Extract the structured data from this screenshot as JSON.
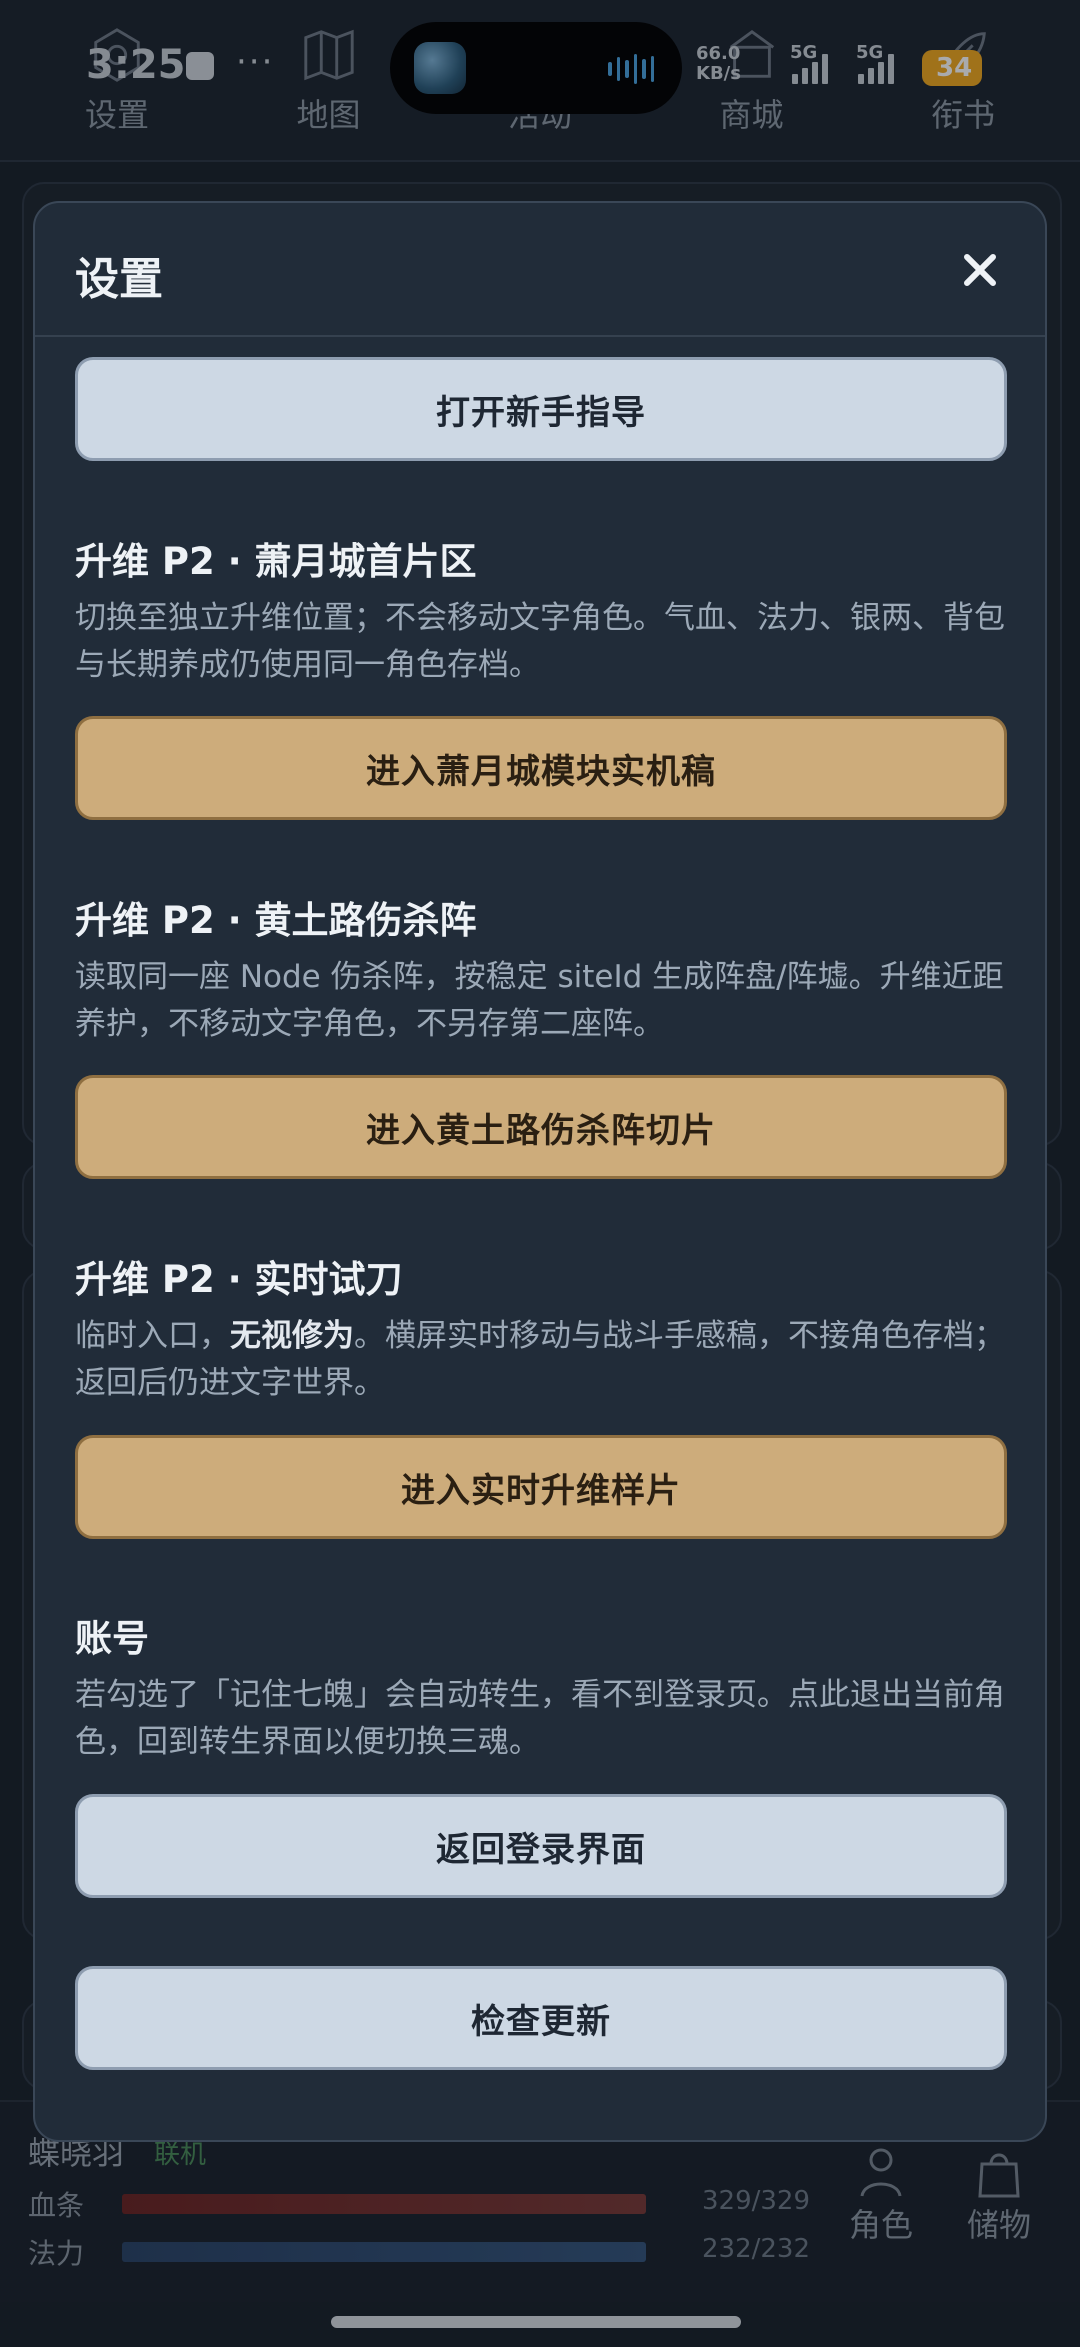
{
  "status_bar": {
    "time": "3:25",
    "dots": "···",
    "net_speed_value": "66.0",
    "net_speed_unit": "KB/s",
    "sim1": "5G",
    "sim2": "5G",
    "battery": "34"
  },
  "top_nav": {
    "items": [
      {
        "label": "设置",
        "icon": "gear-icon"
      },
      {
        "label": "地图",
        "icon": "map-icon"
      },
      {
        "label": "活动",
        "icon": "flag-icon"
      },
      {
        "label": "商城",
        "icon": "shop-icon"
      },
      {
        "label": "衔书",
        "icon": "feather-icon"
      }
    ]
  },
  "modal": {
    "title": "设置",
    "close_icon": "close-icon",
    "tutorial_button": "打开新手指导",
    "sections": [
      {
        "title": "升维 P2 · 萧月城首片区",
        "desc": "切换至独立升维位置；不会移动文字角色。气血、法力、银两、背包与长期养成仍使用同一角色存档。",
        "button": "进入萧月城模块实机稿"
      },
      {
        "title": "升维 P2 · 黄土路伤杀阵",
        "desc": "读取同一座 Node 伤杀阵，按稳定 siteId 生成阵盘/阵墟。升维近距养护，不移动文字角色，不另存第二座阵。",
        "button": "进入黄土路伤杀阵切片"
      },
      {
        "title": "升维 P2 · 实时试刀",
        "desc_prefix": "临时入口，",
        "desc_bold": "无视修为",
        "desc_suffix": "。横屏实时移动与战斗手感稿，不接角色存档；返回后仍进文字世界。",
        "button": "进入实时升维样片"
      },
      {
        "title": "账号",
        "desc": "若勾选了「记住七魄」会自动转生，看不到登录页。点此退出当前角色，回到转生界面以便切换三魂。",
        "button": "返回登录界面"
      }
    ],
    "update_button": "检查更新"
  },
  "character_bar": {
    "name": "蝶晓羽",
    "status": "联机",
    "hp_label": "血条",
    "hp_value": "329/329",
    "hp_fraction": 1.0,
    "mp_label": "法力",
    "mp_value": "232/232",
    "mp_fraction": 1.0,
    "role_button": "角色",
    "storage_button": "储物",
    "colors": {
      "hp": "#6b2a2a",
      "mp": "#2f4d72"
    }
  }
}
